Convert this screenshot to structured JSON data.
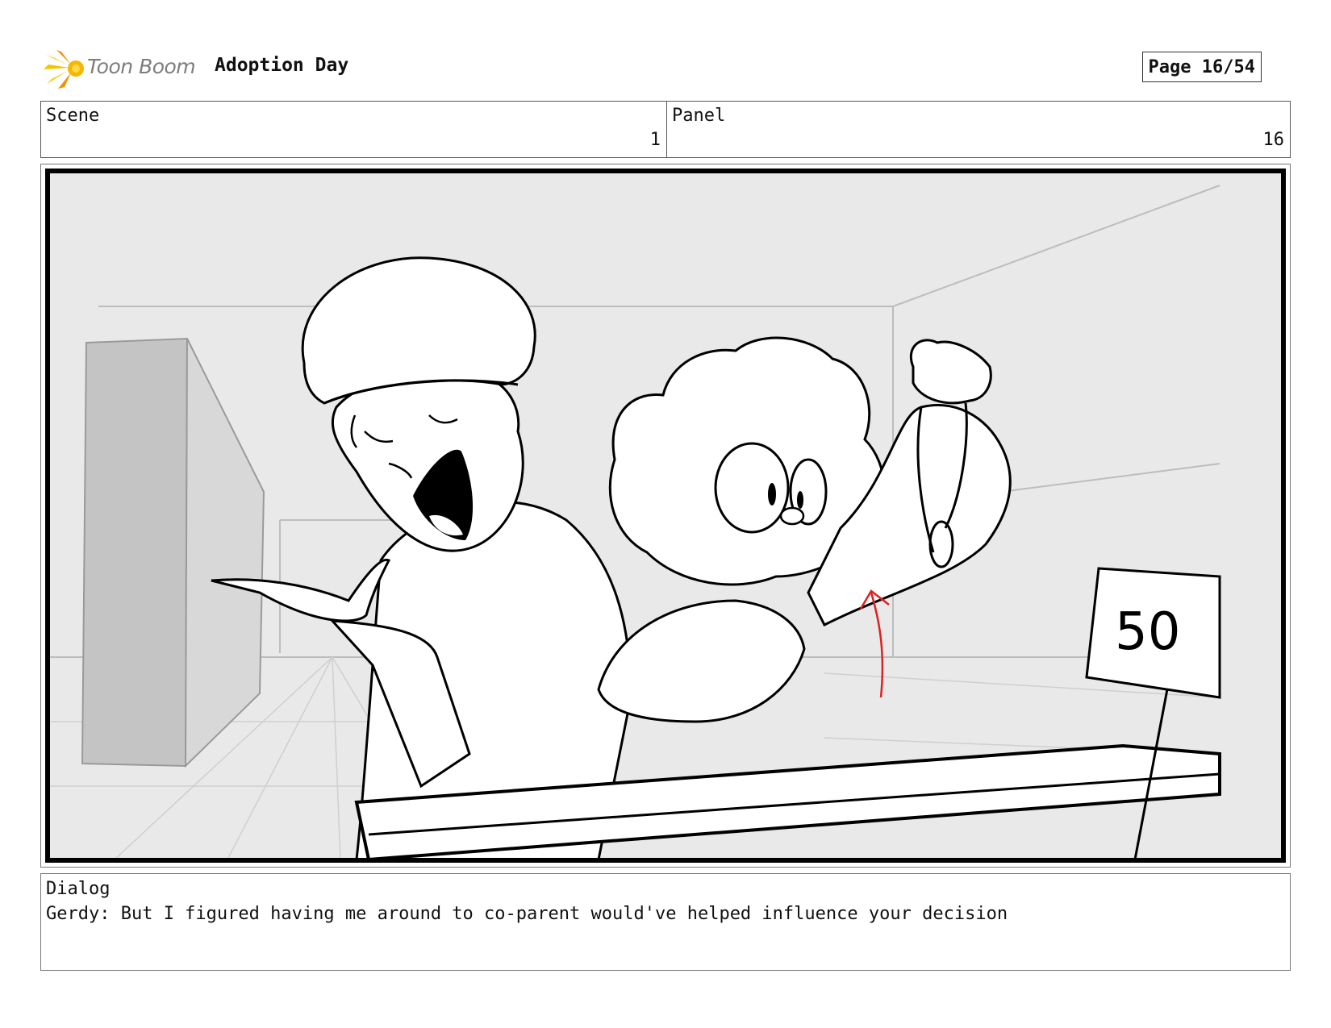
{
  "header": {
    "logo_text": "Toon Boom",
    "project_title": "Adoption Day",
    "page_label": "Page 16/54"
  },
  "info": {
    "scene_label": "Scene",
    "scene_value": "1",
    "panel_label": "Panel",
    "panel_value": "16"
  },
  "artwork": {
    "description_icon": "storyboard-sketch",
    "sign_text": "50",
    "accent_color": "#e02020"
  },
  "dialog": {
    "label": "Dialog",
    "text": "Gerdy: But I figured having me around to co-parent would've helped influence your decision"
  },
  "colors": {
    "logo_yellow": "#f5c400",
    "logo_orange": "#f29100"
  }
}
